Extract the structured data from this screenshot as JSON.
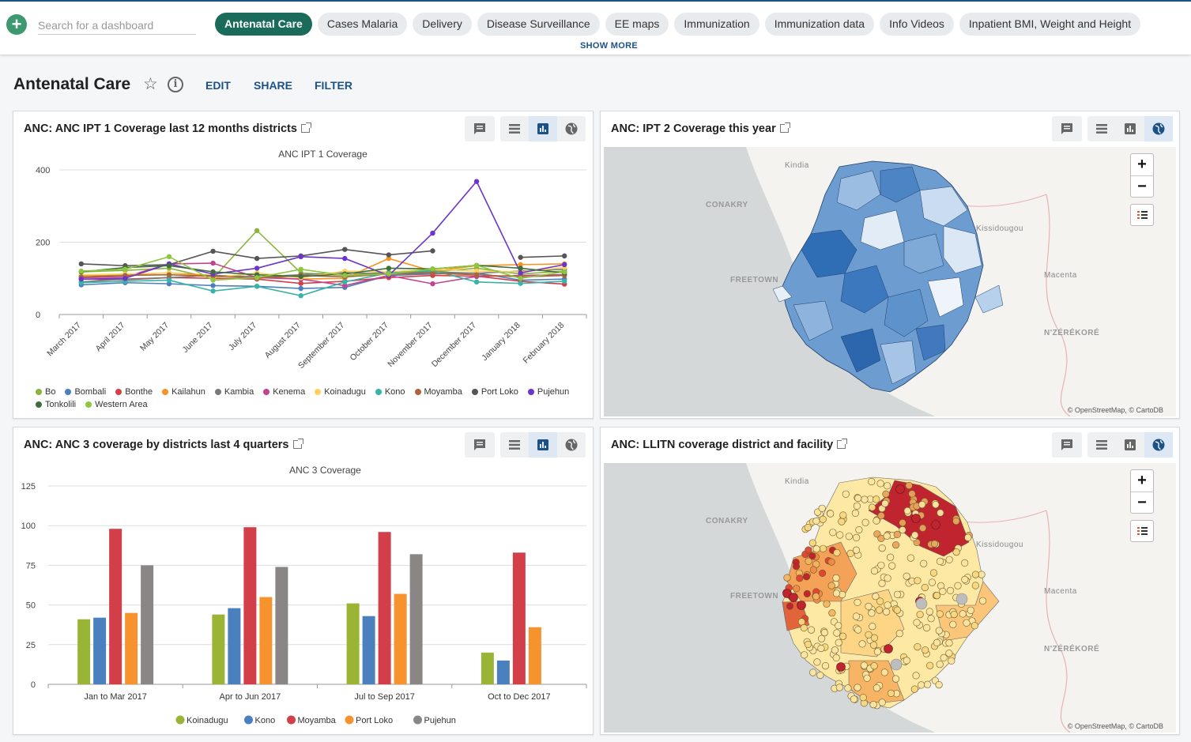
{
  "search": {
    "placeholder": "Search for a dashboard"
  },
  "dashboards": [
    "Antenatal Care",
    "Cases Malaria",
    "Delivery",
    "Disease Surveillance",
    "EE maps",
    "Immunization",
    "Immunization data",
    "Info Videos",
    "Inpatient BMI, Weight and Height"
  ],
  "show_more": "SHOW MORE",
  "dashboard": {
    "title": "Antenatal Care",
    "edit": "EDIT",
    "share": "SHARE",
    "filter": "FILTER"
  },
  "panels": {
    "p1": {
      "title": "ANC: ANC IPT 1 Coverage last 12 months districts"
    },
    "p2": {
      "title": "ANC: IPT 2 Coverage this year",
      "attribution": "© OpenStreetMap, © CartoDB"
    },
    "p3": {
      "title": "ANC: ANC 3 coverage by districts last 4 quarters"
    },
    "p4": {
      "title": "ANC: LLITN coverage district and facility",
      "attribution": "© OpenStreetMap, © CartoDB"
    }
  },
  "map_labels": {
    "kindia": "Kindia",
    "conakry": "CONAKRY",
    "kissidougou": "Kissidougou",
    "freetown": "FREETOWN",
    "macenta": "Macenta",
    "nzerekore": "N'ZÉRÉKORÉ"
  },
  "colors": {
    "accent": "#1d5288",
    "active_chip": "#1a6b5a"
  },
  "chart_data": [
    {
      "type": "line",
      "title": "ANC IPT 1 Coverage",
      "categories": [
        "March 2017",
        "April 2017",
        "May 2017",
        "June 2017",
        "July 2017",
        "August 2017",
        "September 2017",
        "October 2017",
        "November 2017",
        "December 2017",
        "January 2018",
        "February 2018"
      ],
      "ylim": [
        0,
        400
      ],
      "yticks": [
        0,
        200,
        400
      ],
      "series": [
        {
          "name": "Bo",
          "color": "#8cb33b",
          "values": [
            118,
            122,
            128,
            100,
            232,
            115,
            108,
            118,
            118,
            128,
            112,
            120
          ]
        },
        {
          "name": "Bombali",
          "color": "#4d7fbf",
          "values": [
            82,
            88,
            85,
            80,
            78,
            72,
            75,
            108,
            112,
            115,
            95,
            98
          ]
        },
        {
          "name": "Bonthe",
          "color": "#d33f49",
          "values": [
            98,
            96,
            102,
            100,
            98,
            86,
            92,
            102,
            108,
            106,
            92,
            84
          ]
        },
        {
          "name": "Kailahun",
          "color": "#f7931e",
          "values": [
            108,
            110,
            115,
            108,
            105,
            98,
            100,
            155,
            120,
            135,
            138,
            140
          ]
        },
        {
          "name": "Kambia",
          "color": "#7a7a7a",
          "values": [
            90,
            98,
            102,
            108,
            104,
            110,
            116,
            112,
            118,
            114,
            120,
            125
          ]
        },
        {
          "name": "Kenema",
          "color": "#c2448f",
          "values": [
            102,
            104,
            140,
            142,
            102,
            98,
            80,
            108,
            85,
            105,
            108,
            110
          ]
        },
        {
          "name": "Koinadugu",
          "color": "#fcd25b",
          "values": [
            110,
            112,
            115,
            102,
            115,
            102,
            120,
            118,
            125,
            120,
            118,
            130
          ]
        },
        {
          "name": "Kono",
          "color": "#37b3a8",
          "values": [
            88,
            92,
            95,
            65,
            78,
            52,
            90,
            115,
            122,
            90,
            86,
            92
          ]
        },
        {
          "name": "Moyamba",
          "color": "#a9663c",
          "values": [
            104,
            108,
            110,
            106,
            100,
            108,
            104,
            112,
            114,
            110,
            104,
            108
          ]
        },
        {
          "name": "Port Loko",
          "color": "#555555",
          "values": [
            140,
            135,
            138,
            175,
            155,
            162,
            180,
            165,
            176,
            null,
            158,
            162
          ]
        },
        {
          "name": "Pujehun",
          "color": "#6c35c9",
          "values": [
            98,
            100,
            140,
            112,
            128,
            160,
            155,
            108,
            225,
            368,
            115,
            138
          ]
        },
        {
          "name": "Tonkolili",
          "color": "#3e6e3a",
          "values": [
            118,
            130,
            135,
            118,
            110,
            105,
            112,
            128,
            126,
            136,
            128,
            115
          ]
        },
        {
          "name": "Western Area",
          "color": "#8dc63f",
          "values": [
            120,
            125,
            160,
            95,
            102,
            125,
            108,
            112,
            126,
            136,
            100,
            118
          ]
        }
      ]
    },
    {
      "type": "bar",
      "title": "ANC 3 Coverage",
      "categories": [
        "Jan to Mar 2017",
        "Apr to Jun 2017",
        "Jul to Sep 2017",
        "Oct to Dec 2017"
      ],
      "ylim": [
        0,
        125
      ],
      "yticks": [
        0,
        25,
        50,
        75,
        100,
        125
      ],
      "series": [
        {
          "name": "Koinadugu",
          "color": "#9ab535",
          "values": [
            41,
            44,
            51,
            20
          ]
        },
        {
          "name": "Kono",
          "color": "#4a80be",
          "values": [
            42,
            48,
            43,
            15
          ]
        },
        {
          "name": "Moyamba",
          "color": "#d33f49",
          "values": [
            98,
            99,
            96,
            83
          ]
        },
        {
          "name": "Port Loko",
          "color": "#f7932e",
          "values": [
            45,
            55,
            57,
            36
          ]
        },
        {
          "name": "Pujehun",
          "color": "#8a8686",
          "values": [
            75,
            74,
            82,
            null
          ]
        }
      ]
    }
  ]
}
